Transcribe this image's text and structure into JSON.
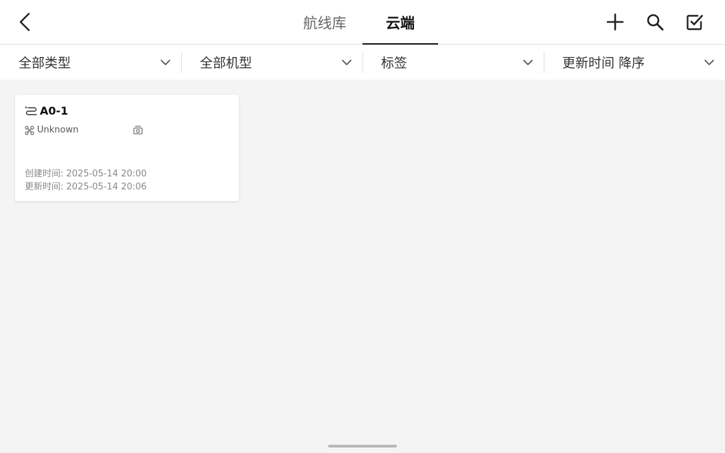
{
  "header": {
    "tabs": [
      {
        "label": "航线库",
        "active": false
      },
      {
        "label": "云端",
        "active": true
      }
    ],
    "icons": {
      "back": "chevron-left-icon",
      "add": "plus-icon",
      "search": "search-icon",
      "select": "checkbox-icon"
    }
  },
  "filters": [
    {
      "label": "全部类型"
    },
    {
      "label": "全部机型"
    },
    {
      "label": "标签"
    },
    {
      "label": "更新时间 降序"
    }
  ],
  "routes": [
    {
      "name": "A0-1",
      "drone_model": "Unknown",
      "created_label": "创建时间: 2025-05-14 20:00",
      "updated_label": "更新时间: 2025-05-14 20:06"
    }
  ],
  "colors": {
    "background": "#f4f4f4",
    "surface": "#ffffff",
    "active_tab": "#111111",
    "inactive_tab": "#666666"
  }
}
